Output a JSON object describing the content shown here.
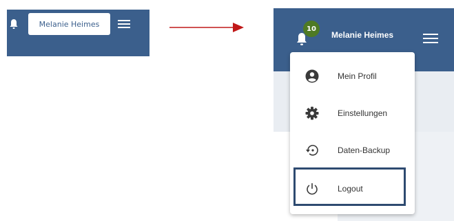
{
  "before": {
    "user_name": "Melanie Heimes",
    "colors": {
      "header": "#3b5f8c"
    },
    "icons": [
      "bell-icon",
      "hamburger-menu-icon"
    ]
  },
  "after": {
    "user_name": "Melanie Heimes",
    "notification_count": "10",
    "colors": {
      "header": "#3b5f8c",
      "badge": "#4e7a24",
      "highlight": "#2e4a70"
    },
    "menu": {
      "items": [
        {
          "label": "Mein Profil",
          "icon": "user-circle-icon"
        },
        {
          "label": "Einstellungen",
          "icon": "gear-icon"
        },
        {
          "label": "Daten-Backup",
          "icon": "backup-restore-icon"
        },
        {
          "label": "Logout",
          "icon": "power-icon",
          "highlighted": true
        }
      ]
    }
  }
}
